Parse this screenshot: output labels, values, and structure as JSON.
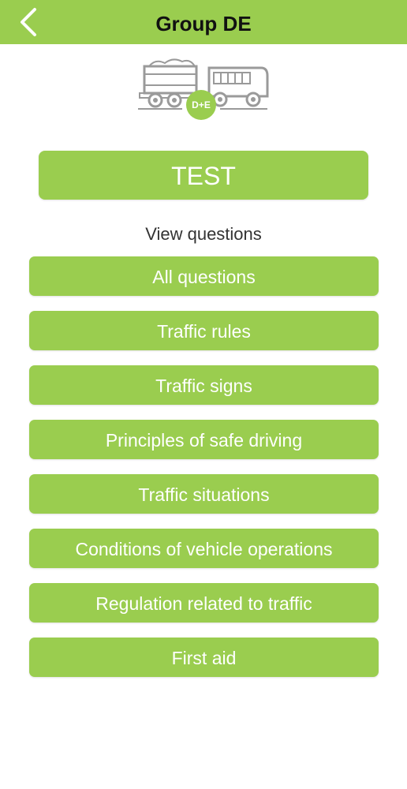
{
  "header": {
    "title": "Group DE",
    "back_icon": "chevron-left-icon"
  },
  "illustration": {
    "icon": "truck-bus-icon",
    "badge": "D+E"
  },
  "test_button": {
    "label": "TEST"
  },
  "section_label": "View questions",
  "categories": [
    {
      "label": "All questions"
    },
    {
      "label": "Traffic rules"
    },
    {
      "label": "Traffic signs"
    },
    {
      "label": "Principles of safe driving"
    },
    {
      "label": "Traffic situations"
    },
    {
      "label": "Conditions of vehicle operations"
    },
    {
      "label": "Regulation related to traffic"
    },
    {
      "label": "First aid"
    }
  ],
  "colors": {
    "accent": "#9acd4f",
    "button_text": "#ffffff",
    "title_text": "#111111"
  }
}
